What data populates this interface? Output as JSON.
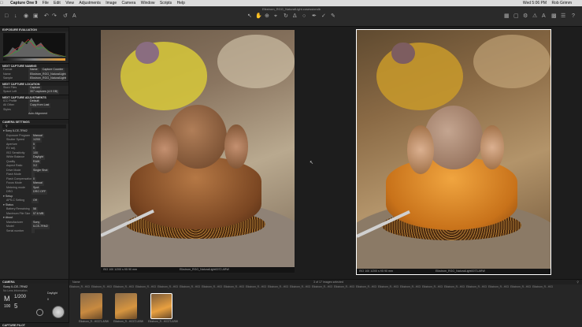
{
  "menubar": {
    "app_name": "Capture One 9",
    "items": [
      "File",
      "Edit",
      "View",
      "Adjustments",
      "Image",
      "Camera",
      "Window",
      "Scripts",
      "Help"
    ],
    "clock": "Wed 5:06 PM",
    "user": "Rob Grimm"
  },
  "toolbar": {
    "document_title": "Elkstrom_RGG_NaturalLight.cosessiondb"
  },
  "sidebar": {
    "exposure_evaluation_title": "EXPOSURE EVALUATION",
    "next_capture_naming_title": "NEXT CAPTURE NAMING",
    "naming_format_label": "Format",
    "naming_format_value": "Name",
    "naming_counter_value": "Capture Counter",
    "naming_name_label": "Name",
    "naming_name_value": "Elkstrom_RGG_NaturalLight",
    "naming_sample_label": "Sample",
    "naming_sample_value": "Elkstrom_RGG_NaturalLight0073.ARW",
    "next_capture_location_title": "NEXT CAPTURE LOCATION",
    "store_files_label": "Store Files",
    "store_files_value": "Capture",
    "space_left_label": "Space Left",
    "space_left_value": "307 captures (4.9 GB)",
    "next_capture_adjustments_title": "NEXT CAPTURE ADJUSTMENTS",
    "icc_label": "ICC Profile",
    "icc_value": "Default",
    "all_other_label": "All Other",
    "all_other_value": "Copy from Last",
    "styles_label": "Styles",
    "auto_alignment": "Auto Alignment",
    "camera_settings_title": "CAMERA SETTINGS",
    "camera_model": "Sony ILCE-7RM2",
    "camera_rows": [
      {
        "k": "Exposure Program",
        "v": "Manual"
      },
      {
        "k": "Shutter Speed",
        "v": "1/200"
      },
      {
        "k": "Aperture",
        "v": "5"
      },
      {
        "k": "EV adj.",
        "v": "0"
      },
      {
        "k": "ISO Sensitivity",
        "v": "100"
      },
      {
        "k": "White Balance",
        "v": "Daylight"
      },
      {
        "k": "Quality",
        "v": "RAW"
      },
      {
        "k": "Aspect Ratio",
        "v": "3:2"
      },
      {
        "k": "Drive Mode",
        "v": "Single Shot"
      },
      {
        "k": "Flash Mode",
        "v": ""
      },
      {
        "k": "Flash Compensation",
        "v": "0"
      },
      {
        "k": "Focus Mode",
        "v": "Manual"
      },
      {
        "k": "Metering mode",
        "v": "Spot"
      },
      {
        "k": "DRO",
        "v": "DRO OFF"
      }
    ],
    "setup_title": "Setup",
    "setup_rows": [
      {
        "k": "APS-C Setting",
        "v": "Off"
      }
    ],
    "status_title": "Status",
    "status_rows": [
      {
        "k": "Battery Remaining",
        "v": "58"
      },
      {
        "k": "Maximum File Size",
        "v": "57.6 MB"
      }
    ],
    "about_title": "About",
    "about_rows": [
      {
        "k": "Manufacturer",
        "v": "Sony"
      },
      {
        "k": "Model",
        "v": "ILCE-7RM2"
      },
      {
        "k": "Serial number",
        "v": ""
      }
    ]
  },
  "camera_panel": {
    "title": "CAMERA",
    "model": "Sony ILCE-7RM2",
    "lens": "No Lens Information",
    "mode": "M",
    "shutter": "1/200",
    "iso": "100",
    "aperture": "5",
    "wb": "Daylight",
    "ev": "0",
    "footer": "CAPTURE PILOT"
  },
  "viewer": {
    "left_info": "ISO 100   1/200 s   f/5   90 mm",
    "left_filename": "Elkstrom_RGG_NaturalLight0072.ARW",
    "right_info": "ISO 100   1/200 s   f/5   90 mm",
    "right_filename": "Elkstrom_RGG_NaturalLight0073.ARW"
  },
  "filmstrip": {
    "header": "Name",
    "count": "3 of 17 images selected",
    "names": [
      "Elkstrom_R...H0327.ARW",
      "Elkstrom_R...H0328.ARW",
      "Elkstrom_R...H0329.ARW",
      "Elkstrom_R...H0330.ARW",
      "Elkstrom_R...H0331.ARW",
      "Elkstrom_R...H0332.ARW",
      "Elkstrom_R...H0333.ARW",
      "Elkstrom_R...H0334.ARW",
      "Elkstrom_R...H0335.ARW",
      "Elkstrom_R...H0336.ARW",
      "Elkstrom_R...H0337.ARW",
      "Elkstrom_R...H0338.ARW",
      "Elkstrom_R...H0339.ARW",
      "Elkstrom_R...H0340.ARW",
      "Elkstrom_R...H0341.ARW",
      "Elkstrom_R...H0342.ARW",
      "Elkstrom_R...H0343.ARW",
      "Elkstrom_R...H0344.ARW",
      "Elkstrom_R...H0345.ARW",
      "Elkstrom_R...H0346.ARW",
      "Elkstrom_R...H0347.ARW",
      "Elkstrom_R...H0348.ARW"
    ],
    "thumb_names": [
      "Elkstrom_R...H0371.ARW",
      "Elkstrom_R...H0372.ARW",
      "Elkstrom_R...H0373.ARW"
    ]
  },
  "colors": {
    "accent": "#f0a030",
    "selection": "#ffffff",
    "caramel": "#c87a2a",
    "chocolate": "#8a5a38"
  }
}
